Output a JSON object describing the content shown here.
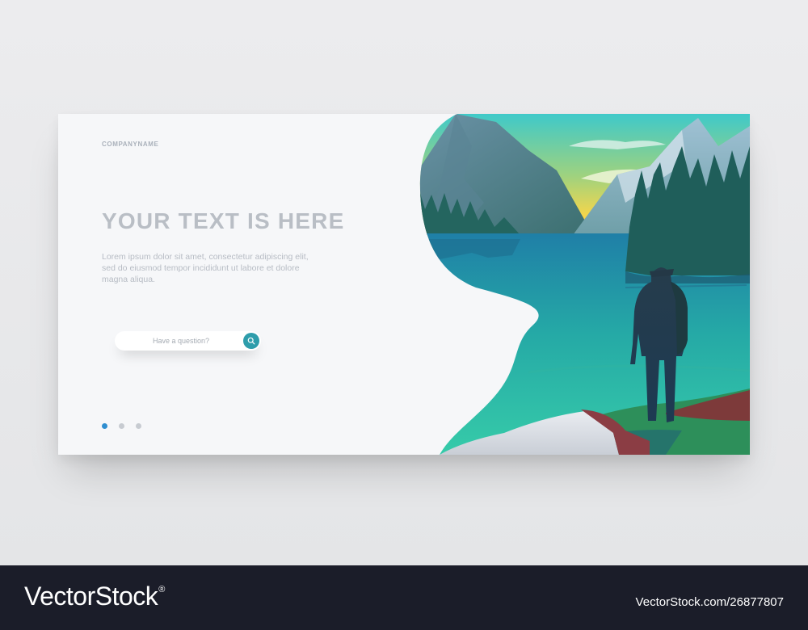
{
  "hero": {
    "brand": "COMPANYNAME",
    "headline": "YOUR TEXT IS HERE",
    "body": "Lorem ipsum dolor sit amet, consectetur adipiscing elit, sed do eiusmod tempor incididunt ut labore et dolore magna aliqua."
  },
  "search": {
    "placeholder": "Have a question?",
    "icon": "search-icon"
  },
  "carousel": {
    "count": 3,
    "active_index": 0
  },
  "footer": {
    "logo": "VectorStock",
    "mark": "®",
    "id_text": "VectorStock.com/26877807"
  },
  "colors": {
    "accent": "#2e9dab",
    "active_dot": "#2f8ed0",
    "footer_bg": "#1b1d29"
  }
}
